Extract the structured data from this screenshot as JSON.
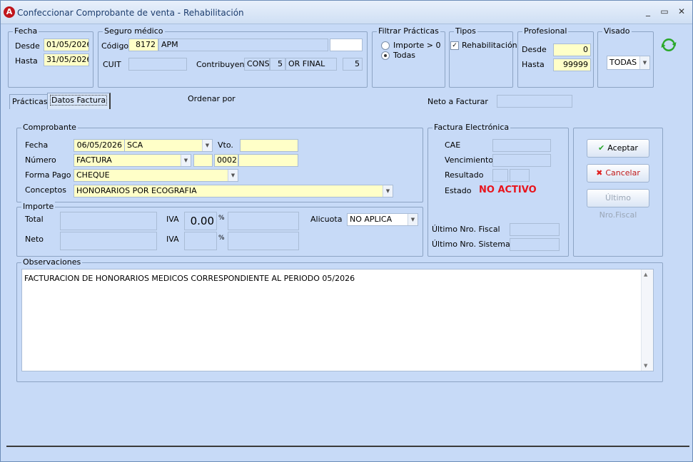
{
  "window": {
    "title": "Confeccionar Comprobante de venta - Rehabilitación",
    "minimize": "_",
    "maximize": "▭",
    "close": "✕"
  },
  "fecha": {
    "group": "Fecha",
    "desde_label": "Desde",
    "desde": "01/05/2026",
    "hasta_label": "Hasta",
    "hasta": "31/05/2026"
  },
  "seguro": {
    "group": "Seguro médico",
    "codigo_label": "Código",
    "codigo": "8172",
    "nombre": "APM",
    "extra": "",
    "cuit_label": "CUIT",
    "cuit": "",
    "contribuyente_label": "Contribuyente",
    "contrib_a": "CONSU",
    "contrib_b": "5",
    "contrib_c": "OR FINAL",
    "contrib_d": "5"
  },
  "filtrar": {
    "group": "Filtrar Prácticas",
    "opt1": "Importe > 0",
    "opt2": "Todas"
  },
  "tipos": {
    "group": "Tipos",
    "rehab": "Rehabilitación"
  },
  "profesional": {
    "group": "Profesional",
    "desde_label": "Desde",
    "desde": "0",
    "hasta_label": "Hasta",
    "hasta": "99999"
  },
  "visado": {
    "group": "Visado",
    "value": "TODAS"
  },
  "tabs": {
    "practicas": "Prácticas",
    "datos": "Datos Factura"
  },
  "ordenar_label": "Ordenar por",
  "neto_facturar_label": "Neto a Facturar",
  "neto_facturar": "",
  "comprobante": {
    "group": "Comprobante",
    "fecha_label": "Fecha",
    "fecha": "06/05/2026",
    "sca": "SCA",
    "vto_label": "Vto.",
    "vto": "",
    "numero_label": "Número",
    "tipo": "FACTURA",
    "punto": "",
    "numero": "0002",
    "numero_rest": "",
    "forma_label": "Forma Pago",
    "forma": "CHEQUE",
    "conceptos_label": "Conceptos",
    "conceptos": "HONORARIOS POR ECOGRAFIA"
  },
  "importe": {
    "group": "Importe",
    "total_label": "Total",
    "total": "",
    "iva_label": "IVA",
    "iva_value": "0.00",
    "pct": "%",
    "iva_amount": "",
    "alicuota_label": "Alicuota",
    "alicuota": "NO APLICA",
    "neto_label": "Neto",
    "neto": "",
    "iva2_label": "IVA",
    "iva2_value": "",
    "pct2": "%",
    "iva2_amount": ""
  },
  "fe": {
    "group": "Factura Electrónica",
    "cae_label": "CAE",
    "cae": "",
    "venc_label": "Vencimiento",
    "venc": "",
    "resultado_label": "Resultado",
    "estado_label": "Estado",
    "estado": "NO ACTIVO",
    "estado_color": "#e8141c",
    "ult_fiscal_label": "Último Nro. Fiscal",
    "ult_sistema_label": "Último Nro. Sistema"
  },
  "buttons": {
    "aceptar": "Aceptar",
    "cancelar": "Cancelar",
    "ultimo": "Último Nro.Fiscal"
  },
  "observaciones": {
    "group": "Observaciones",
    "text": "FACTURACION DE HONORARIOS MEDICOS CORRESPONDIENTE AL PERIODO 05/2026"
  },
  "icons": {
    "app": "app-logo-icon",
    "refresh": "refresh-icon",
    "check": "check-icon",
    "cancel": "cancel-icon"
  }
}
